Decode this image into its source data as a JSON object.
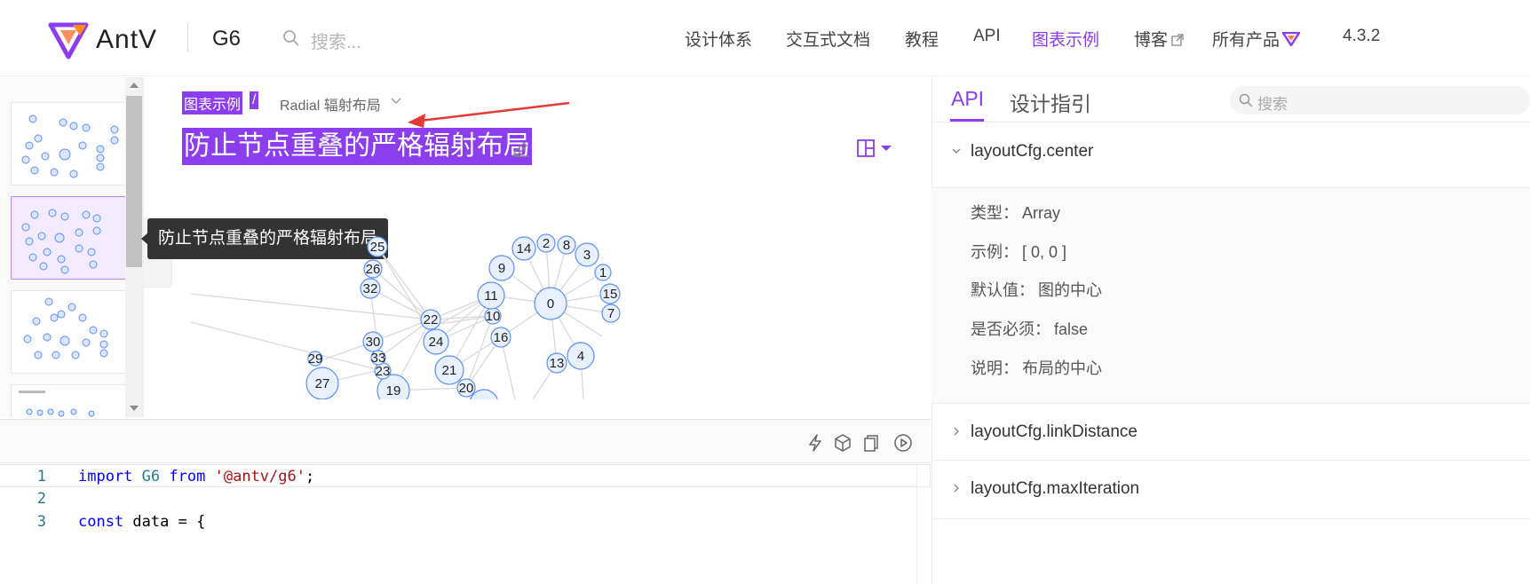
{
  "header": {
    "logo_text": "AntV",
    "product": "G6",
    "search_placeholder": "搜索...",
    "nav": [
      {
        "label": "设计体系"
      },
      {
        "label": "交互式文档"
      },
      {
        "label": "教程"
      },
      {
        "label": "API"
      },
      {
        "label": "图表示例",
        "active": true
      },
      {
        "label": "博客",
        "external": true
      },
      {
        "label": "所有产品",
        "dropdown": true
      },
      {
        "label": "4.3.2"
      }
    ]
  },
  "breadcrumb": {
    "root": "图表示例",
    "separator": "/",
    "current": "Radial 辐射布局"
  },
  "page_title": "防止节点重叠的严格辐射布局",
  "tooltip": "防止节点重叠的严格辐射布局",
  "graph_labels": [
    "0",
    "1",
    "2",
    "3",
    "4",
    "7",
    "8",
    "9",
    "10",
    "11",
    "13",
    "14",
    "15",
    "16",
    "19",
    "20",
    "21",
    "22",
    "23",
    "24",
    "25",
    "26",
    "27",
    "29",
    "30",
    "32",
    "33"
  ],
  "editor": {
    "lines": [
      {
        "n": "1",
        "tokens": [
          {
            "t": "import",
            "c": "kw"
          },
          {
            "t": " ",
            "c": ""
          },
          {
            "t": "G6",
            "c": "id"
          },
          {
            "t": " ",
            "c": ""
          },
          {
            "t": "from",
            "c": "kw"
          },
          {
            "t": " ",
            "c": ""
          },
          {
            "t": "'@antv/g6'",
            "c": "str"
          },
          {
            "t": ";",
            "c": ""
          }
        ]
      },
      {
        "n": "2",
        "tokens": []
      },
      {
        "n": "3",
        "tokens": [
          {
            "t": "const",
            "c": "kw"
          },
          {
            "t": " data = {",
            "c": ""
          }
        ]
      }
    ]
  },
  "right_panel": {
    "tabs": [
      {
        "label": "API",
        "active": true
      },
      {
        "label": "设计指引"
      }
    ],
    "search_placeholder": "搜索",
    "sections": [
      {
        "title": "layoutCfg.center",
        "expanded": true,
        "props": [
          {
            "key": "类型：",
            "value": "Array"
          },
          {
            "key": "示例：",
            "value": "[ 0, 0 ]"
          },
          {
            "key": "默认值：",
            "value": "图的中心"
          },
          {
            "key": "是否必须：",
            "value": "false"
          },
          {
            "key": "说明：",
            "value": "布局的中心"
          }
        ]
      },
      {
        "title": "layoutCfg.linkDistance",
        "expanded": false
      },
      {
        "title": "layoutCfg.maxIteration",
        "expanded": false
      }
    ]
  },
  "colors": {
    "accent": "#8c3dee",
    "node_fill": "#e8f0fe",
    "node_stroke": "#5b8ff9",
    "edge": "#d9d9d9"
  }
}
